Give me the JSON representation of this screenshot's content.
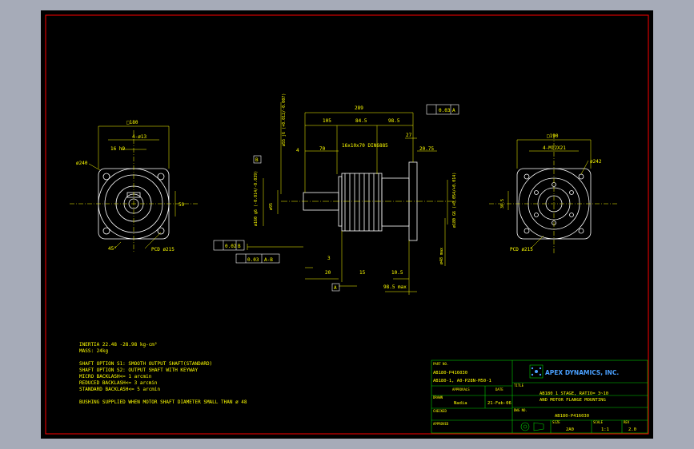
{
  "colors": {
    "background": "#a6abb8",
    "sheet": "#000000",
    "border": "#ff0000",
    "geometry": "#ffffff",
    "dimension": "#ffff00",
    "titleblock": "#00d000",
    "company": "#4aa0ff"
  },
  "left_view": {
    "square": "□180",
    "bolt": "4-ø13",
    "key": "16 h9",
    "dia_outer": "ø240",
    "pcd": "PCD ø215",
    "angle": "45°",
    "height": "59"
  },
  "middle_view": {
    "length_total": "289",
    "len_105": "105",
    "len_845": "84.5",
    "len_985": "98.5",
    "len_70": "70",
    "len_4": "4",
    "len_27": "27",
    "len_2075": "20.75",
    "key_spec": "16x10x70 DIN6885",
    "dia_shaft": "ø55 j6 (+0.012/-0.007)",
    "dia_95": "ø95",
    "dia_160": "ø160 g6 (-0.014/-0.039)",
    "dia_180": "ø180 G6 (+0.054/+0.014)",
    "dia_48": "ø48 max",
    "len_3": "3",
    "len_20": "20",
    "len_15": "15",
    "len_105b": "10.5",
    "len_985max": "98.5 max",
    "tol_flat": "0.03",
    "datum_a": "A",
    "tol_par": "0.02",
    "datum_b": "B",
    "tol_run": "0.03",
    "datum_ab": "A-B",
    "tol_top": "0.03",
    "datum_top": "A"
  },
  "right_view": {
    "square": "□190",
    "bolt": "4-M12X21",
    "dia": "ø242",
    "dim_365": "36.5",
    "pcd": "PCD ø215"
  },
  "notes": [
    "INERTIA    22.48 -28.98 kg-cm²",
    "MASS: 24kg",
    "SHAFT OPTION S1: SMOOTH OUTPUT SHAFT(STANDARD)",
    "SHAFT OPTION S2: OUTPUT SHAFT WITH KEYWAY",
    "MICRO BACKLASH<= 1 arcmin",
    "REDUCED BACKLASH<= 3 arcmin",
    "STANDARD BACKLASH<= 5 arcmin",
    "BUSHING SUPPLIED WHEN MOTOR SHAFT DIAMETER SMALL THAN ø 48"
  ],
  "title_block": {
    "part_no_label": "PART NO.",
    "part_no_1": "AB180-P416030",
    "part_no_2": "AB180-1, A0-P28N-M50-1",
    "company": "APEX DYNAMICS, INC.",
    "approved_label": "APPROVALS",
    "date_label": "DATE",
    "drawn_label": "DRAWN",
    "drawn_by": "Nadia",
    "drawn_date": "21-Feb-06",
    "checked_label": "CHECKED",
    "approved2_label": "APPROVED",
    "title_label": "TITLE",
    "title_1": "AB180 1 STAGE, RATIO= 3~10",
    "title_2": "AND MOTOR FLANGE MOUNTING",
    "dwg_label": "DWG NO.",
    "dwg_no": "AB180-P416030",
    "size_label": "SIZE",
    "size": "2A0",
    "scale_label": "SCALE",
    "scale": "1:1",
    "rev_label": "REV",
    "rev": "2.0"
  }
}
